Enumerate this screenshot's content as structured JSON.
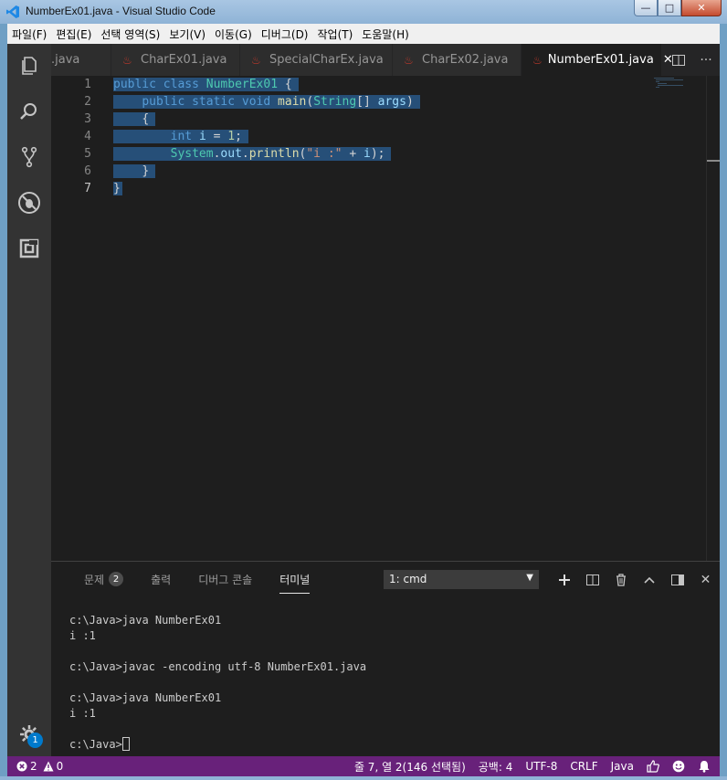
{
  "window": {
    "title": "NumberEx01.java - Visual Studio Code",
    "minimize_label": "—",
    "maximize_label": "□",
    "close_label": "✕"
  },
  "menu": [
    "파일(F)",
    "편집(E)",
    "선택 영역(S)",
    "보기(V)",
    "이동(G)",
    "디버그(D)",
    "작업(T)",
    "도움말(H)"
  ],
  "tabs": [
    {
      "label": ".java",
      "active": false
    },
    {
      "label": "CharEx01.java",
      "active": false
    },
    {
      "label": "SpecialCharEx.java",
      "active": false
    },
    {
      "label": "CharEx02.java",
      "active": false
    },
    {
      "label": "NumberEx01.java",
      "active": true
    }
  ],
  "editor": {
    "line_numbers": [
      "1",
      "2",
      "3",
      "4",
      "5",
      "6",
      "7"
    ],
    "current_line": 7
  },
  "panel": {
    "tabs": {
      "problems": "문제",
      "problems_count": "2",
      "output": "출력",
      "debug_console": "디버그 콘솔",
      "terminal": "터미널"
    },
    "terminal_select": "1: cmd",
    "terminal_lines": [
      "c:\\Java>java NumberEx01",
      "i :1",
      "",
      "c:\\Java>javac -encoding utf-8 NumberEx01.java",
      "",
      "c:\\Java>java NumberEx01",
      "i :1",
      ""
    ],
    "prompt": "c:\\Java>"
  },
  "activity": {
    "settings_badge": "1"
  },
  "status": {
    "errors": "2",
    "warnings": "0",
    "position": "줄 7, 열 2(146 선택됨)",
    "spaces": "공백: 4",
    "encoding": "UTF-8",
    "eol": "CRLF",
    "language": "Java"
  },
  "colors": {
    "status_bar": "#68217a",
    "selection": "#264f78",
    "accent": "#007acc"
  }
}
